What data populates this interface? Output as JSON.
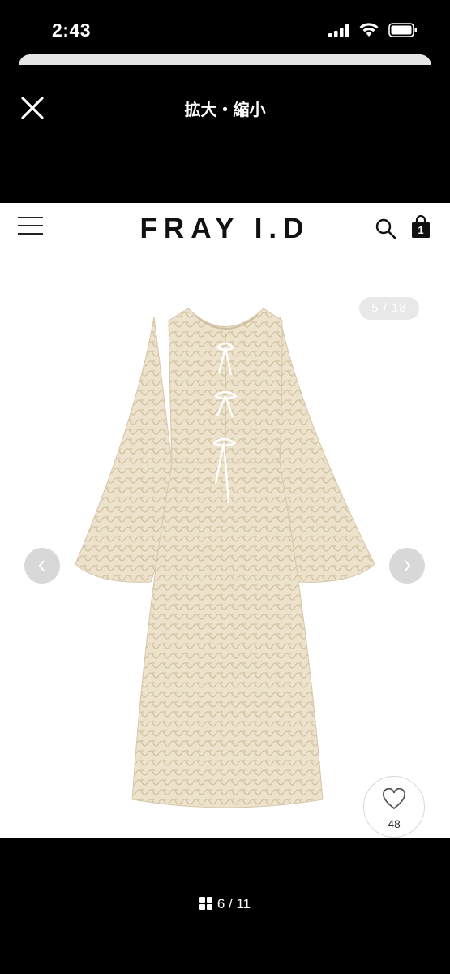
{
  "status_bar": {
    "time": "2:43"
  },
  "sheet": {
    "title": "拡大・縮小"
  },
  "site": {
    "logo": "FRAY I.D",
    "cart_count": "1",
    "image_counter": "5 / 18",
    "favorite_count": "48"
  },
  "viewer": {
    "page_indicator": "6 / 11"
  },
  "icons": [
    "close-icon",
    "menu-icon",
    "search-icon",
    "bag-icon",
    "chevron-left-icon",
    "chevron-right-icon",
    "heart-icon",
    "grid-icon"
  ]
}
